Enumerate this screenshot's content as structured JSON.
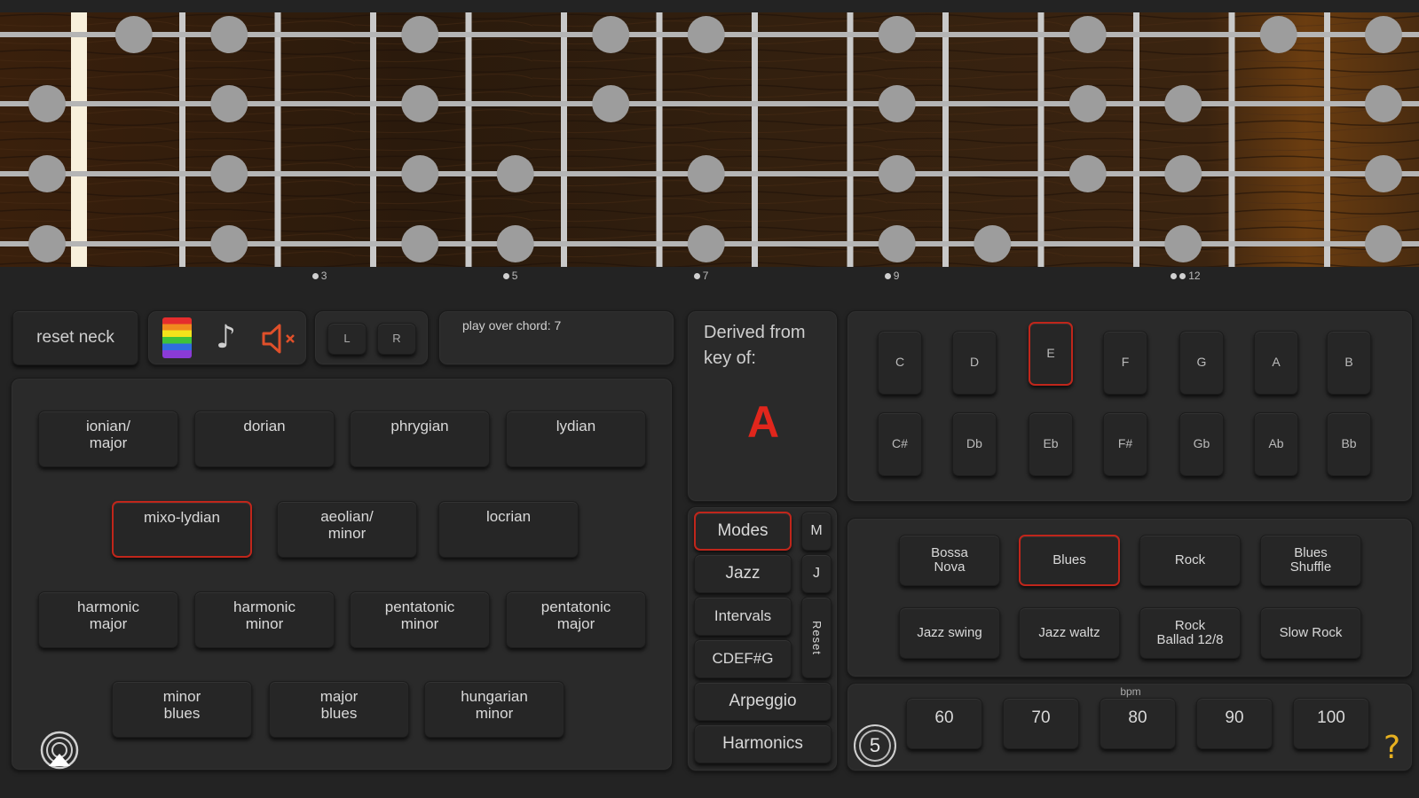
{
  "neck": {
    "frets": 14,
    "string_dots": [
      [
        1,
        2,
        4,
        6,
        7,
        9,
        11,
        13,
        14
      ],
      [
        0,
        2,
        4,
        6,
        9,
        11,
        12,
        14
      ],
      [
        0,
        2,
        4,
        5,
        7,
        9,
        11,
        12,
        14
      ],
      [
        0,
        2,
        4,
        5,
        7,
        9,
        10,
        12,
        14
      ]
    ],
    "markers": [
      {
        "fret": 3,
        "label": "3",
        "dots": 1
      },
      {
        "fret": 5,
        "label": "5",
        "dots": 1
      },
      {
        "fret": 7,
        "label": "7",
        "dots": 1
      },
      {
        "fret": 9,
        "label": "9",
        "dots": 1
      },
      {
        "fret": 12,
        "label": "12",
        "dots": 2
      }
    ]
  },
  "toolbar": {
    "reset_neck": "reset neck",
    "left": "L",
    "right": "R",
    "play_over": "play over chord: 7"
  },
  "scales": [
    {
      "label": "ionian/\nmajor",
      "selected": false
    },
    {
      "label": "dorian",
      "selected": false
    },
    {
      "label": "phrygian",
      "selected": false
    },
    {
      "label": "lydian",
      "selected": false
    },
    {
      "label": "mixo-lydian",
      "selected": true
    },
    {
      "label": "aeolian/\nminor",
      "selected": false
    },
    {
      "label": "locrian",
      "selected": false
    },
    {
      "label": "harmonic\nmajor",
      "selected": false
    },
    {
      "label": "harmonic\nminor",
      "selected": false
    },
    {
      "label": "pentatonic\nminor",
      "selected": false
    },
    {
      "label": "pentatonic\nmajor",
      "selected": false
    },
    {
      "label": "minor\nblues",
      "selected": false
    },
    {
      "label": "major\nblues",
      "selected": false
    },
    {
      "label": "hungarian\nminor",
      "selected": false
    }
  ],
  "derived": {
    "label": "Derived from key of:",
    "key": "A"
  },
  "categories": {
    "modes": "Modes",
    "jazz": "Jazz",
    "intervals": "Intervals",
    "cdefg": "CDEF#G",
    "arpeggio": "Arpeggio",
    "harmonics": "Harmonics",
    "m": "M",
    "j": "J",
    "reset": "Reset"
  },
  "keys": {
    "naturals": [
      "C",
      "D",
      "E",
      "F",
      "G",
      "A",
      "B"
    ],
    "accidentals": [
      "C#",
      "Db",
      "Eb",
      "F#",
      "Gb",
      "Ab",
      "Bb"
    ],
    "selected": "E"
  },
  "rhythms": [
    {
      "label": "Bossa\nNova",
      "selected": false
    },
    {
      "label": "Blues",
      "selected": true
    },
    {
      "label": "Rock",
      "selected": false
    },
    {
      "label": "Blues\nShuffle",
      "selected": false
    },
    {
      "label": "Jazz swing",
      "selected": false
    },
    {
      "label": "Jazz waltz",
      "selected": false
    },
    {
      "label": "Rock\nBallad 12/8",
      "selected": false
    },
    {
      "label": "Slow Rock",
      "selected": false
    }
  ],
  "tempo": {
    "unit": "bpm",
    "values": [
      "60",
      "70",
      "80",
      "90",
      "100"
    ],
    "count": "5",
    "help": "?"
  },
  "colors": {
    "accent": "#c0261b",
    "dot": "#9d9d9d",
    "wood": "#3a2410"
  }
}
